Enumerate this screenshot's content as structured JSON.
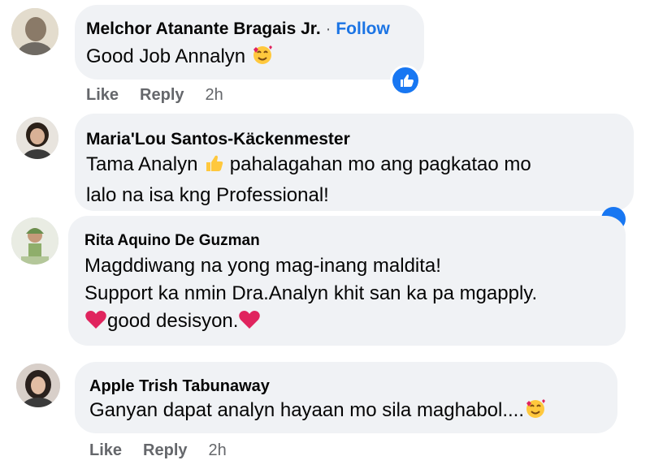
{
  "comments": [
    {
      "author": "Melchor Atanante Bragais Jr.",
      "follow_sep": " · ",
      "follow": "Follow",
      "lines": [
        "Good Job Annalyn"
      ],
      "actions": {
        "like": "Like",
        "reply": "Reply",
        "time": "2h"
      },
      "reaction_icon": "thumbs-up-icon"
    },
    {
      "author": "Maria'Lou Santos-Käckenmester",
      "lines": [
        "Tama Analyn",
        "pahalagahan mo ang pagkatao mo",
        "lalo na isa kng Professional!"
      ]
    },
    {
      "author": "Rita Aquino De Guzman",
      "lines": [
        "Magddiwang na yong mag-inang maldita!",
        "Support ka nmin Dra.Analyn khit san ka pa mgapply.",
        "good desisyon."
      ]
    },
    {
      "author": "Apple Trish Tabunaway",
      "lines": [
        "Ganyan dapat analyn hayaan mo sila maghabol...."
      ],
      "actions": {
        "like": "Like",
        "reply": "Reply",
        "time": "2h"
      }
    }
  ],
  "colors": {
    "bubble": "#f0f2f5",
    "link": "#1b74e4",
    "meta": "#65676b",
    "reaction": "#1877f2",
    "heart": "#e0245e"
  }
}
